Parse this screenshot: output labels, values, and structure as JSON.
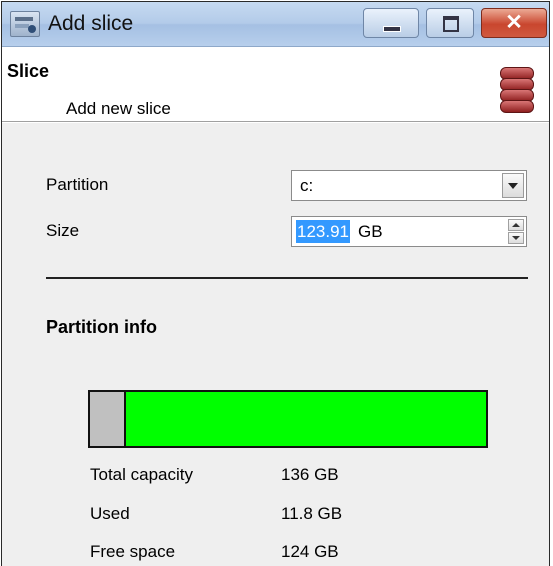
{
  "window": {
    "title": "Add slice",
    "icon": "add-slice-app-icon",
    "controls": {
      "minimize_icon": "minimize-icon",
      "maximize_icon": "maximize-icon",
      "close_glyph": "✕"
    }
  },
  "header": {
    "title": "Slice",
    "subtitle": "Add new slice",
    "icon": "database-stack-icon",
    "icon_color": "#b23a3a"
  },
  "form": {
    "partition": {
      "label": "Partition",
      "value": "c:"
    },
    "size": {
      "label": "Size",
      "value_selected": "123.91",
      "unit": "GB"
    }
  },
  "partition_info": {
    "title": "Partition info",
    "used_fraction": 0.087,
    "used_color": "#c0c0c0",
    "free_color": "#00ff00",
    "rows": [
      {
        "label": "Total capacity",
        "value": "136 GB"
      },
      {
        "label": "Used",
        "value": "11.8 GB"
      },
      {
        "label": "Free space",
        "value": "124 GB"
      }
    ]
  }
}
